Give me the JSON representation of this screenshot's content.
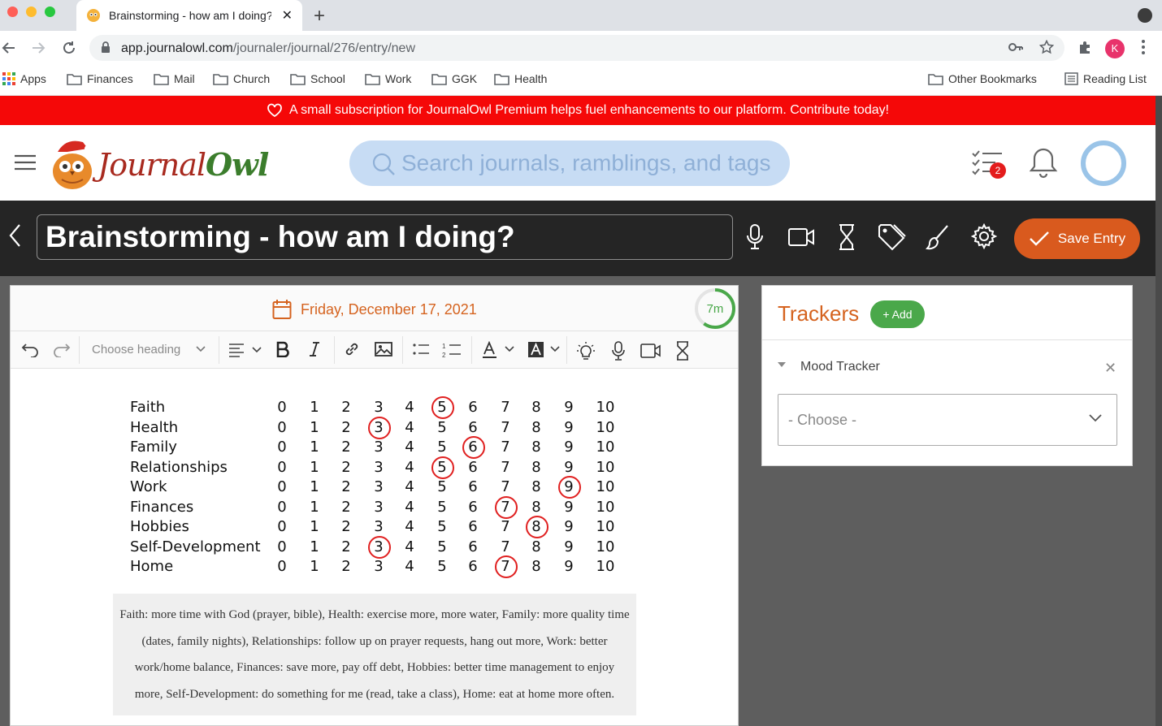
{
  "browser": {
    "tab_title": "Brainstorming - how am I doing?",
    "url_host": "app.journalowl.com",
    "url_path": "/journaler/journal/276/entry/new",
    "profile_initial": "K",
    "bookmarks": [
      "Apps",
      "Finances",
      "Mail",
      "Church",
      "School",
      "Work",
      "GGK",
      "Health"
    ],
    "other_bookmarks": "Other Bookmarks",
    "reading_list": "Reading List"
  },
  "promo": {
    "text": "A small subscription for JournalOwl Premium helps fuel enhancements to our platform. Contribute today!"
  },
  "header": {
    "logo_word1": "Journal",
    "logo_word2": "Owl",
    "search_placeholder": "Search journals, ramblings, and tags",
    "task_badge": "2"
  },
  "entry": {
    "title": "Brainstorming - how am I doing?",
    "save_label": "Save Entry",
    "date": "Friday, December 17, 2021",
    "timer": "7m",
    "timer_fraction": 0.6
  },
  "toolbar": {
    "heading_placeholder": "Choose heading"
  },
  "mood": {
    "scale": [
      "0",
      "1",
      "2",
      "3",
      "4",
      "5",
      "6",
      "7",
      "8",
      "9",
      "10"
    ],
    "rows": [
      {
        "label": "Faith",
        "selected": 5
      },
      {
        "label": "Health",
        "selected": 3
      },
      {
        "label": "Family",
        "selected": 6
      },
      {
        "label": "Relationships",
        "selected": 5
      },
      {
        "label": "Work",
        "selected": 9
      },
      {
        "label": "Finances",
        "selected": 7
      },
      {
        "label": "Hobbies",
        "selected": 8
      },
      {
        "label": "Self-Development",
        "selected": 3
      },
      {
        "label": "Home",
        "selected": 7
      }
    ]
  },
  "notes": {
    "text": "Faith: more time with God (prayer, bible), Health: exercise more, more water, Family: more quality time (dates, family nights), Relationships: follow up on prayer requests, hang out more, Work: better work/home balance, Finances: save more, pay off debt, Hobbies: better time management to enjoy more, Self-Development: do something for me (read, take a class), Home: eat at home more often."
  },
  "trackers": {
    "title": "Trackers",
    "add_label": "+ Add",
    "item_name": "Mood Tracker",
    "choose_value": "- Choose -"
  },
  "colors": {
    "accent": "#d95a1e",
    "green": "#4aa84a",
    "promo_red": "#f50808",
    "circle_red": "#e02020"
  }
}
